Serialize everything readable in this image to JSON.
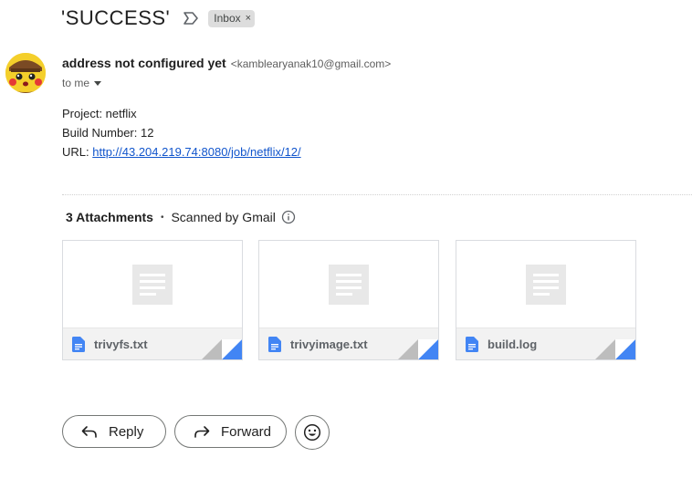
{
  "email": {
    "subject": "'SUCCESS'",
    "label": "Inbox",
    "label_remove": "×",
    "sender_name": "address not configured yet",
    "sender_email": "<kamblearyanak10@gmail.com>",
    "recipient": "to me"
  },
  "body": {
    "project": "Project: netflix",
    "build_number": "Build Number: 12",
    "url_label": "URL: ",
    "url": "http://43.204.219.74:8080/job/netflix/12/"
  },
  "attachments": {
    "count_label": "3 Attachments",
    "separator": "•",
    "scanned_label": "Scanned by Gmail",
    "files": [
      {
        "name": "trivyfs.txt"
      },
      {
        "name": "trivyimage.txt"
      },
      {
        "name": "build.log"
      }
    ]
  },
  "actions": {
    "reply": "Reply",
    "forward": "Forward"
  },
  "colors": {
    "link": "#1155cc",
    "file_icon": "#4285f4",
    "chip_bg": "#dddddd"
  }
}
